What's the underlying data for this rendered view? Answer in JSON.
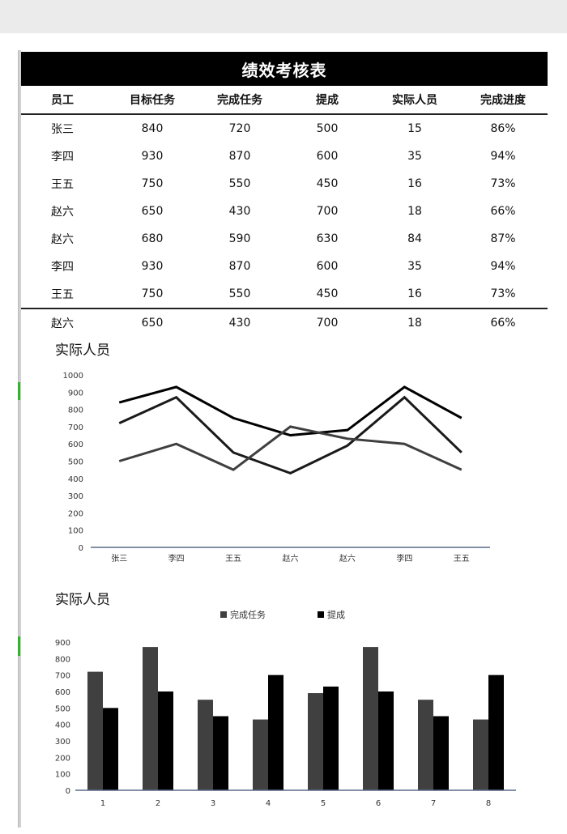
{
  "table": {
    "title": "绩效考核表",
    "columns": [
      "员工",
      "目标任务",
      "完成任务",
      "提成",
      "实际人员",
      "完成进度"
    ],
    "rows": [
      [
        "张三",
        "840",
        "720",
        "500",
        "15",
        "86%"
      ],
      [
        "李四",
        "930",
        "870",
        "600",
        "35",
        "94%"
      ],
      [
        "王五",
        "750",
        "550",
        "450",
        "16",
        "73%"
      ],
      [
        "赵六",
        "650",
        "430",
        "700",
        "18",
        "66%"
      ],
      [
        "赵六",
        "680",
        "590",
        "630",
        "84",
        "87%"
      ],
      [
        "李四",
        "930",
        "870",
        "600",
        "35",
        "94%"
      ],
      [
        "王五",
        "750",
        "550",
        "450",
        "16",
        "73%"
      ],
      [
        "赵六",
        "650",
        "430",
        "700",
        "18",
        "66%"
      ]
    ]
  },
  "chart_data": [
    {
      "type": "line",
      "title": "实际人员",
      "categories": [
        "张三",
        "李四",
        "王五",
        "赵六",
        "赵六",
        "李四",
        "王五"
      ],
      "series": [
        {
          "name": "目标任务",
          "values": [
            840,
            930,
            750,
            650,
            680,
            930,
            750
          ],
          "color": "#000000"
        },
        {
          "name": "完成任务",
          "values": [
            720,
            870,
            550,
            430,
            590,
            870,
            550
          ],
          "color": "#1a1a1a"
        },
        {
          "name": "提成",
          "values": [
            500,
            600,
            450,
            700,
            630,
            600,
            450
          ],
          "color": "#3f3f3f"
        }
      ],
      "yticks": [
        "0",
        "100",
        "200",
        "300",
        "400",
        "500",
        "600",
        "700",
        "800",
        "900",
        "1000"
      ],
      "ylim": [
        0,
        1000
      ],
      "xlabel": "",
      "ylabel": "",
      "grid": false,
      "legend": "none"
    },
    {
      "type": "bar",
      "title": "实际人员",
      "categories": [
        "1",
        "2",
        "3",
        "4",
        "5",
        "6",
        "7",
        "8"
      ],
      "series": [
        {
          "name": "完成任务",
          "values": [
            720,
            870,
            550,
            430,
            590,
            870,
            550,
            430
          ],
          "color": "#404040"
        },
        {
          "name": "提成",
          "values": [
            500,
            600,
            450,
            700,
            630,
            600,
            450,
            700
          ],
          "color": "#000000"
        }
      ],
      "yticks": [
        "0",
        "100",
        "200",
        "300",
        "400",
        "500",
        "600",
        "700",
        "800",
        "900"
      ],
      "ylim": [
        0,
        900
      ],
      "xlabel": "",
      "ylabel": "",
      "grid": false,
      "legend": "top"
    }
  ]
}
